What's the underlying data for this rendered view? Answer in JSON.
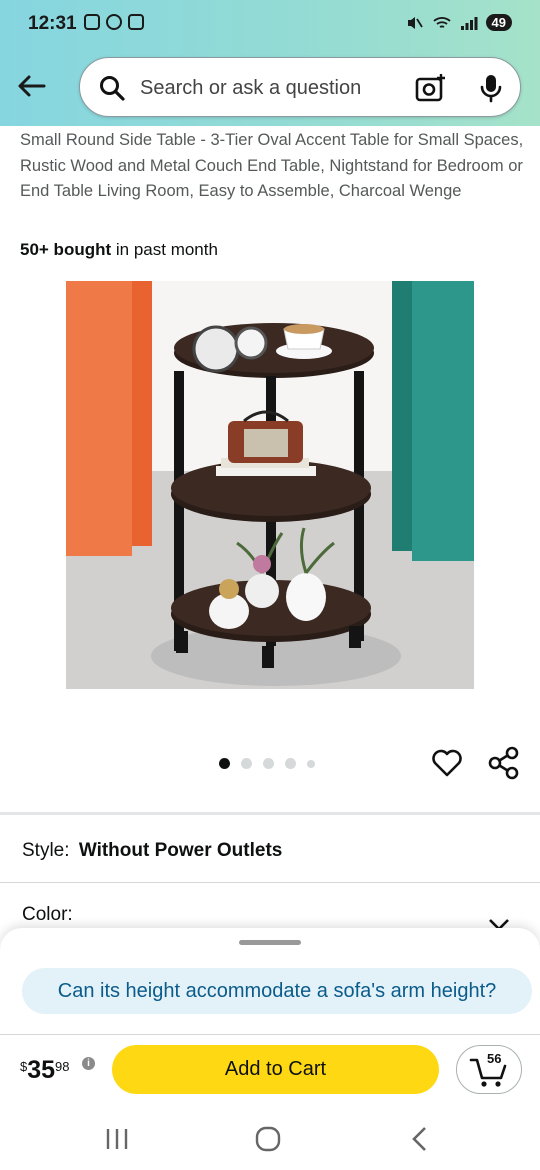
{
  "status_bar": {
    "time": "12:31",
    "battery": "49"
  },
  "search": {
    "placeholder": "Search or ask a question"
  },
  "product": {
    "title": "Small Round Side Table - 3-Tier Oval Accent Table for Small Spaces, Rustic Wood and Metal Couch End Table, Nightstand for Bedroom or End Table Living Room, Easy to Assemble, Charcoal Wenge",
    "bought_bold": "50+ bought",
    "bought_rest": " in past month"
  },
  "gallery": {
    "total_dots": 5,
    "active_index": 0
  },
  "options": {
    "style_label": "Style:",
    "style_value": "Without Power Outlets",
    "color_label": "Color:"
  },
  "sheet": {
    "question": "Can its height accommodate a sofa's arm height?",
    "price_currency": "$",
    "price_whole": "35",
    "price_fraction": "98",
    "add_to_cart": "Add to Cart",
    "cart_count": "56"
  },
  "colors": {
    "accent": "#ffd814",
    "question_bg": "#e3f1f9",
    "question_text": "#0b5c8a"
  }
}
